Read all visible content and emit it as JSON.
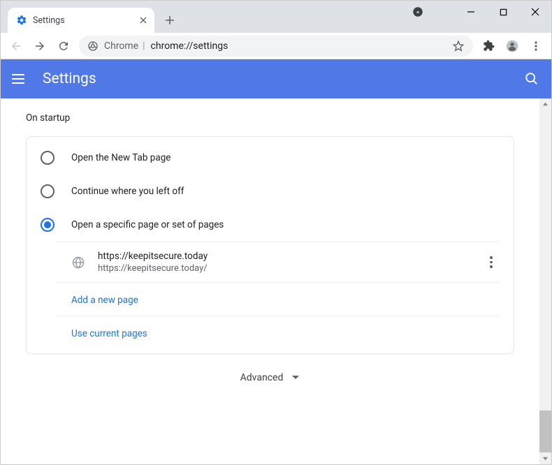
{
  "tab": {
    "title": "Settings"
  },
  "omnibox": {
    "scheme_label": "Chrome",
    "url": "chrome://settings"
  },
  "settings_header": {
    "title": "Settings"
  },
  "section": {
    "label": "On startup"
  },
  "options": [
    {
      "label": "Open the New Tab page"
    },
    {
      "label": "Continue where you left off"
    },
    {
      "label": "Open a specific page or set of pages"
    }
  ],
  "startup_page": {
    "title": "https://keepitsecure.today",
    "url": "https://keepitsecure.today/"
  },
  "links": {
    "add_page": "Add a new page",
    "use_current": "Use current pages"
  },
  "advanced": {
    "label": "Advanced"
  }
}
